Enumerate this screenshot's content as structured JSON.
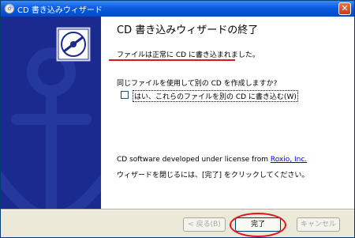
{
  "window": {
    "title": "CD 書き込みウィザード",
    "close_glyph": "✕"
  },
  "content": {
    "heading": "CD 書き込みウィザードの終了",
    "success_message": "ファイルは正常に CD に書き込まれました。",
    "question": "同じファイルを使用して別の CD を作成しますか?",
    "checkbox_label": "はい、これらのファイルを別の CD に書き込む(W)",
    "checkbox_checked": false,
    "license_prefix": "CD software developed under license from ",
    "license_link": "Roxio, Inc.",
    "close_instruction": "ウィザードを閉じるには、[完了] をクリックしてください。"
  },
  "buttons": {
    "back": "< 戻る(B)",
    "finish": "完了",
    "cancel": "キャンセル"
  },
  "colors": {
    "titlebar": "#0a5ce0",
    "banner": "#1b2a8e",
    "annotation": "#e0161c"
  }
}
